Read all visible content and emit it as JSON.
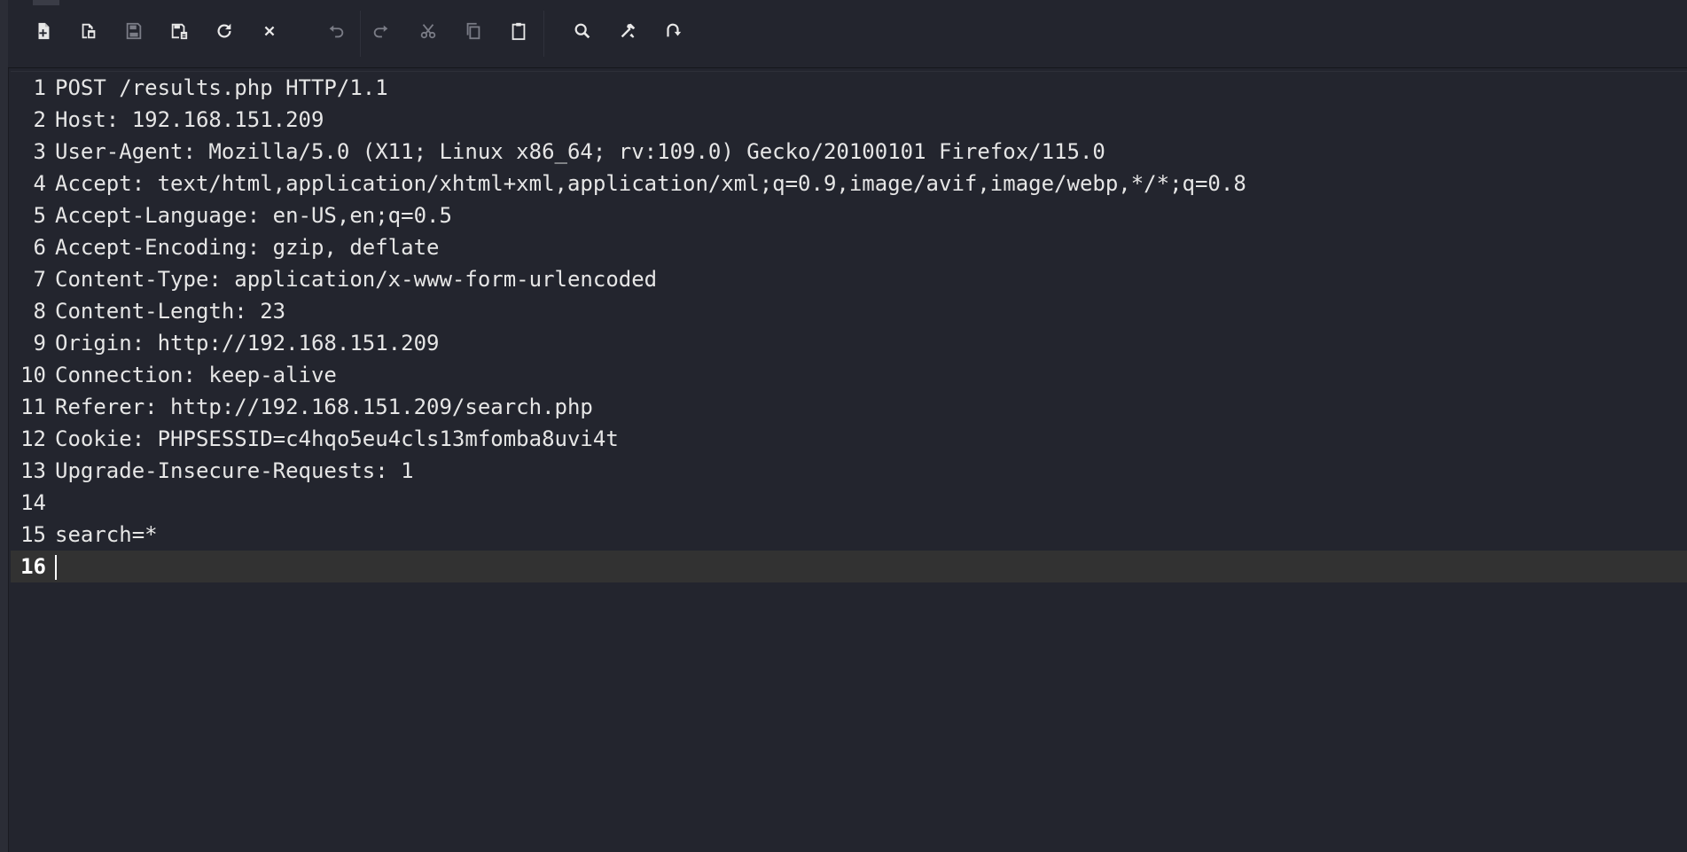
{
  "toolbar": {
    "buttons": [
      {
        "name": "new-file",
        "icon": "file-plus-icon",
        "enabled": true
      },
      {
        "name": "open-file",
        "icon": "file-open-icon",
        "enabled": true
      },
      {
        "name": "save",
        "icon": "save-icon",
        "enabled": false
      },
      {
        "name": "save-as",
        "icon": "save-as-icon",
        "enabled": true
      },
      {
        "name": "reload",
        "icon": "reload-icon",
        "enabled": true
      },
      {
        "name": "close",
        "icon": "close-icon",
        "enabled": true
      },
      {
        "name": "undo",
        "icon": "undo-icon",
        "enabled": false
      },
      {
        "name": "redo",
        "icon": "redo-icon",
        "enabled": false
      },
      {
        "name": "cut",
        "icon": "cut-icon",
        "enabled": false
      },
      {
        "name": "copy",
        "icon": "copy-icon",
        "enabled": false
      },
      {
        "name": "paste",
        "icon": "paste-icon",
        "enabled": true
      },
      {
        "name": "find",
        "icon": "search-icon",
        "enabled": true
      },
      {
        "name": "tools",
        "icon": "hammer-icon",
        "enabled": true
      },
      {
        "name": "replace",
        "icon": "replace-icon",
        "enabled": true
      }
    ],
    "colors": {
      "enabled": "#e8e8e8",
      "disabled": "#7a7c86"
    }
  },
  "editor": {
    "current_line": 16,
    "lines": [
      {
        "n": "1",
        "text": "POST /results.php HTTP/1.1"
      },
      {
        "n": "2",
        "text": "Host: 192.168.151.209"
      },
      {
        "n": "3",
        "text": "User-Agent: Mozilla/5.0 (X11; Linux x86_64; rv:109.0) Gecko/20100101 Firefox/115.0"
      },
      {
        "n": "4",
        "text": "Accept: text/html,application/xhtml+xml,application/xml;q=0.9,image/avif,image/webp,*/*;q=0.8"
      },
      {
        "n": "5",
        "text": "Accept-Language: en-US,en;q=0.5"
      },
      {
        "n": "6",
        "text": "Accept-Encoding: gzip, deflate"
      },
      {
        "n": "7",
        "text": "Content-Type: application/x-www-form-urlencoded"
      },
      {
        "n": "8",
        "text": "Content-Length: 23"
      },
      {
        "n": "9",
        "text": "Origin: http://192.168.151.209"
      },
      {
        "n": "10",
        "text": "Connection: keep-alive"
      },
      {
        "n": "11",
        "text": "Referer: http://192.168.151.209/search.php"
      },
      {
        "n": "12",
        "text": "Cookie: PHPSESSID=c4hqo5eu4cls13mfomba8uvi4t"
      },
      {
        "n": "13",
        "text": "Upgrade-Insecure-Requests: 1"
      },
      {
        "n": "14",
        "text": ""
      },
      {
        "n": "15",
        "text": "search=*"
      },
      {
        "n": "16",
        "text": ""
      }
    ]
  }
}
